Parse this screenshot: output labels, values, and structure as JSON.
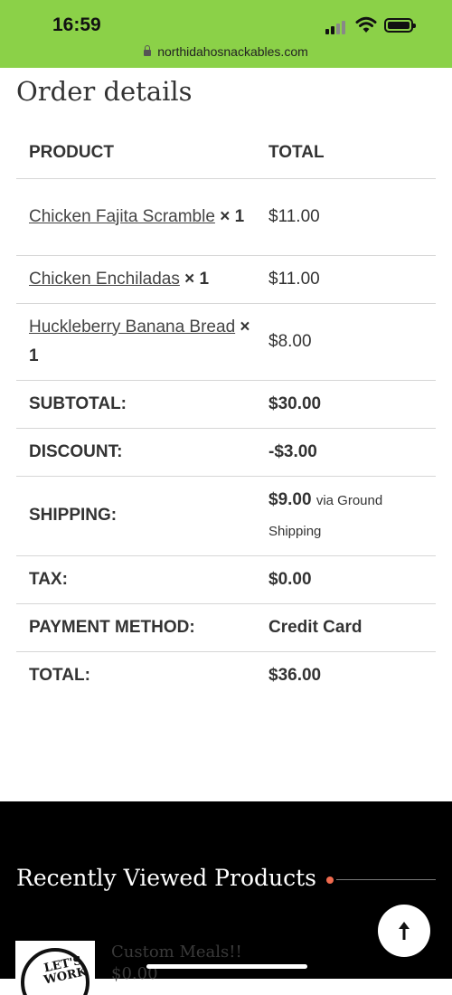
{
  "status_bar": {
    "time": "16:59",
    "url": "northidahosnackables.com"
  },
  "page_title": "Order details",
  "table": {
    "headers": [
      "PRODUCT",
      "TOTAL"
    ],
    "items": [
      {
        "name": "Chicken Fajita Scramble",
        "qty": "× 1",
        "total": "$11.00"
      },
      {
        "name": "Chicken Enchiladas",
        "qty": "× 1",
        "total": "$11.00"
      },
      {
        "name": "Huckleberry Banana Bread",
        "qty": "× 1",
        "total": "$8.00"
      }
    ],
    "totals": [
      {
        "label": "SUBTOTAL:",
        "value": "$30.00"
      },
      {
        "label": "DISCOUNT:",
        "value": "-$3.00"
      },
      {
        "label": "SHIPPING:",
        "value": "$9.00",
        "note": "via Ground Shipping"
      },
      {
        "label": "TAX:",
        "value": "$0.00"
      },
      {
        "label": "PAYMENT METHOD:",
        "value": "Credit Card"
      },
      {
        "label": "TOTAL:",
        "value": "$36.00"
      }
    ]
  },
  "footer": {
    "title": "Recently Viewed Products",
    "product": {
      "name": "Custom Meals!!",
      "price": "$0.00",
      "image_text": "LET'S WORK"
    },
    "accent_color": "#f06a4e"
  },
  "icons": {
    "back_to_top": "arrow-up-icon",
    "lock": "lock-icon",
    "wifi": "wifi-icon",
    "battery": "battery-icon",
    "signal": "signal-icon"
  }
}
